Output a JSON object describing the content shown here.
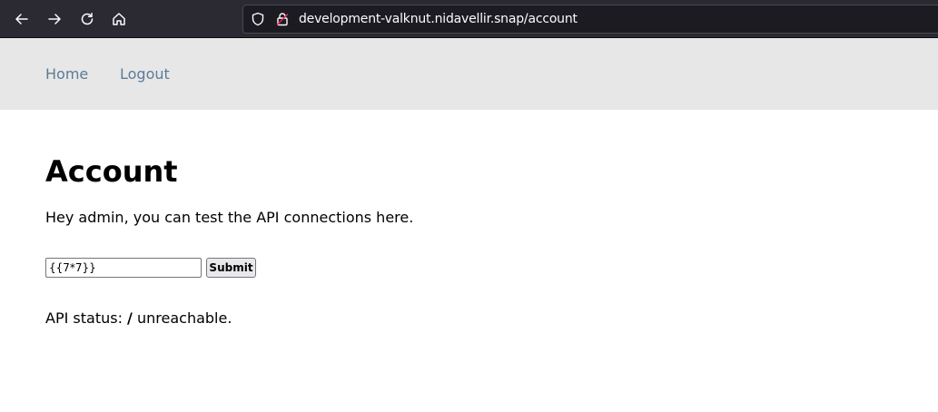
{
  "browser": {
    "url": "development-valknut.nidavellir.snap/account",
    "icons": [
      "back-arrow-icon",
      "forward-arrow-icon",
      "reload-icon",
      "home-icon",
      "shield-icon",
      "lock-icon"
    ]
  },
  "nav": {
    "home_label": "Home",
    "logout_label": "Logout",
    "link_color": "#5c7b97",
    "bar_color": "#e7e7e7"
  },
  "main": {
    "title": "Account",
    "intro": "Hey admin, you can test the API connections here.",
    "form": {
      "input_value": "{{7*7}}",
      "submit_label": "Submit"
    },
    "status": {
      "prefix": "API status:",
      "endpoint": "/",
      "suffix": "unreachable."
    }
  }
}
